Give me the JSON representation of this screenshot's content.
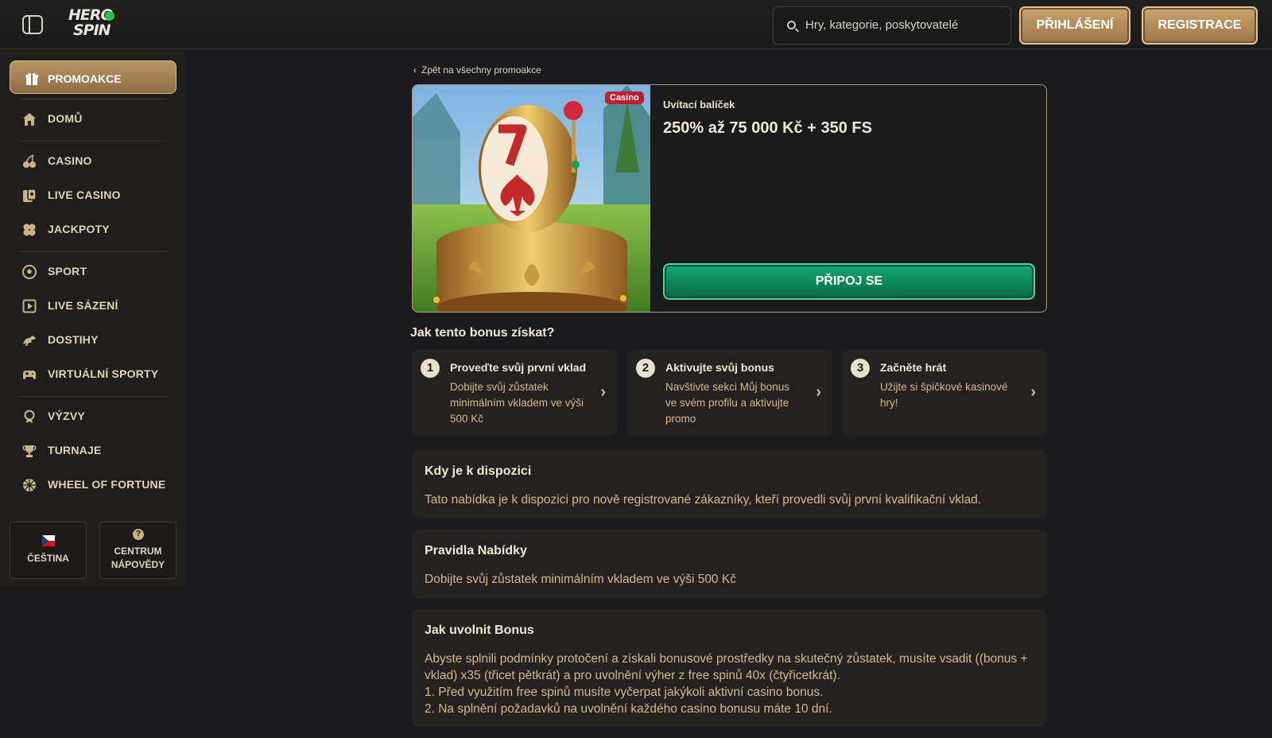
{
  "header": {
    "logo_line1": "HERO",
    "logo_line2": "SPIN",
    "search_placeholder": "Hry, kategorie, poskytovatelé",
    "login_label": "PŘIHLÁŠENÍ",
    "register_label": "REGISTRACE"
  },
  "sidebar": {
    "promo_label": "PROMOAKCE",
    "items": [
      {
        "label": "DOMŮ",
        "icon": "home-icon"
      },
      {
        "label": "CASINO",
        "icon": "cherry-icon"
      },
      {
        "label": "LIVE CASINO",
        "icon": "live-casino-icon"
      },
      {
        "label": "JACKPOTY",
        "icon": "clover-icon"
      },
      {
        "label": "SPORT",
        "icon": "soccer-ball-icon"
      },
      {
        "label": "LIVE SÁZENÍ",
        "icon": "live-betting-icon"
      },
      {
        "label": "DOSTIHY",
        "icon": "horse-icon"
      },
      {
        "label": "VIRTUÁLNÍ SPORTY",
        "icon": "gamepad-icon"
      },
      {
        "label": "VÝZVY",
        "icon": "medal-icon"
      },
      {
        "label": "TURNAJE",
        "icon": "trophy-icon"
      },
      {
        "label": "WHEEL OF FORTUNE",
        "icon": "wheel-icon"
      }
    ],
    "language_label": "ČEŠTINA",
    "help_line1": "CENTRUM",
    "help_line2": "NÁPOVĚDY",
    "help_symbol": "?"
  },
  "main": {
    "back_link": "Zpět na všechny promoakce",
    "badge": "Casino",
    "subtitle": "Uvítací balíček",
    "title": "250% až 75 000 Kč + 350 FS",
    "join_label": "PŘIPOJ SE",
    "how_heading": "Jak tento bonus získat?",
    "steps": [
      {
        "num": "1",
        "title": "Proveďte svůj první vklad",
        "desc": "Dobijte svůj zůstatek minimálním vkladem ve výši 500 Kč"
      },
      {
        "num": "2",
        "title": "Aktivujte svůj bonus",
        "desc": "Navštivte sekci Můj bonus ve svém profilu a aktivujte promo"
      },
      {
        "num": "3",
        "title": "Začněte hrát",
        "desc": "Užijte si špičkové kasinové hry!"
      }
    ],
    "sections": [
      {
        "title": "Kdy je k dispozici",
        "text": [
          "Tato nabídka je k dispozici pro nově registrované zákazníky, kteří provedli svůj první kvalifikační vklad."
        ]
      },
      {
        "title": "Pravidla Nabídky",
        "text": [
          "Dobijte svůj zůstatek minimálním vkladem ve výši 500 Kč"
        ]
      },
      {
        "title": "Jak uvolnit Bonus",
        "text": [
          "Abyste splnili podmínky protočení a získali bonusové prostředky na skutečný zůstatek, musíte vsadit ((bonus + vklad) x35 (třicet pětkrát) a pro uvolnění výher z free spinů 40x (čtyřicetkrát).",
          "1. Před využitím free spinů musíte vyčerpat jakýkoli aktivní casino bonus.",
          "2. Na splnění požadavků na uvolnění každého casino bonusu máte 10 dní."
        ]
      }
    ]
  },
  "colors": {
    "gold": "#b79564",
    "green": "#12a873",
    "text_gold": "#d7b88a",
    "badge_red": "#c31d33"
  }
}
